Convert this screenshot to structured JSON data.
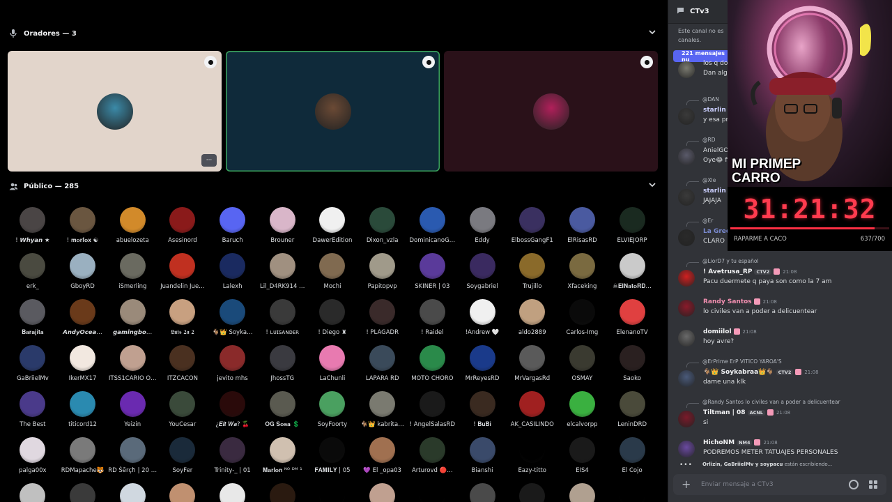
{
  "stage": {
    "speakers_header": "Oradores — 3",
    "audience_header": "Público — 285",
    "speakers": [
      {
        "bg": "#e2d5cb",
        "avatar_color": "#3b8aa8",
        "selected": false,
        "has_more": true
      },
      {
        "bg": "#0f2a3a",
        "avatar_color": "#6b4a35",
        "selected": true,
        "has_more": false
      },
      {
        "bg": "#2a1119",
        "avatar_color": "#b0205a",
        "selected": false,
        "has_more": false
      }
    ],
    "more_label": "···",
    "audience": [
      {
        "name": "! 𝙒𝙝𝙮𝙖𝙣 ★",
        "color": "#4a4545"
      },
      {
        "name": "! 𝐦𝐨𝐫𝐟𝐨𝐱 ☯",
        "color": "#6a5640"
      },
      {
        "name": "abuelozeta",
        "color": "#d28a2a"
      },
      {
        "name": "Asesinord",
        "color": "#8a1a1a"
      },
      {
        "name": "Baruch",
        "color": "#5865f2"
      },
      {
        "name": "Brouner",
        "color": "#d9b6c9"
      },
      {
        "name": "DawerEdition",
        "color": "#f0f0f0"
      },
      {
        "name": "Dixon_vzla",
        "color": "#2a4a3a"
      },
      {
        "name": "DominicanoG…",
        "color": "#2a5ab0"
      },
      {
        "name": "Eddy",
        "color": "#7a7a80"
      },
      {
        "name": "ElbossGangF1",
        "color": "#3a3060"
      },
      {
        "name": "ElRisasRD",
        "color": "#4a5aa0"
      },
      {
        "name": "ELVIEJORP",
        "color": "#1a2a20"
      },
      {
        "name": "erk_",
        "color": "#4a4a40"
      },
      {
        "name": "GboyRD",
        "color": "#9ab0c0"
      },
      {
        "name": "iSmerling",
        "color": "#6a6a60"
      },
      {
        "name": "Juandelin Jue…",
        "color": "#c03020"
      },
      {
        "name": "Lalexh",
        "color": "#1a2a60"
      },
      {
        "name": "Lil_D4RK914 …",
        "color": "#a09080"
      },
      {
        "name": "Mochi",
        "color": "#806a50"
      },
      {
        "name": "Papitopvp",
        "color": "#a09a8a"
      },
      {
        "name": "SKINER | 03",
        "color": "#5a3a9a"
      },
      {
        "name": "Soygabriel",
        "color": "#3a2a60"
      },
      {
        "name": "Trujillo",
        "color": "#8a6a2a"
      },
      {
        "name": "Xfaceking",
        "color": "#7a6a40"
      },
      {
        "name": "☠𝐄𝐥𝐍𝐚𝐭𝐨𝐑𝐃…",
        "color": "#cacaca"
      },
      {
        "name": "𝐁𝐚𝐫𝐚𝐣𝐢𝐭𝐚",
        "color": "#5a5a60"
      },
      {
        "name": "𝘼𝙣𝙙𝙮𝙊𝙘𝙚𝙖…",
        "color": "#6a3a1a"
      },
      {
        "name": "𝙜𝙖𝙢𝙞𝙣𝙜𝙗𝙤…",
        "color": "#9a8a7a"
      },
      {
        "name": "𝕷𝖚𝖎𝖘 𝟐𝖆 𝟐",
        "color": "#c8a080"
      },
      {
        "name": "🐐👑 Soyka…",
        "color": "#1a4a7a"
      },
      {
        "name": "! ʟᴜɪsᴀɴᴅᴇʀ",
        "color": "#3a3a3a"
      },
      {
        "name": "! Diego ♜",
        "color": "#2a2a2a"
      },
      {
        "name": "! PLAGADR",
        "color": "#3a2a2a"
      },
      {
        "name": "! Raidel",
        "color": "#4a4a4a"
      },
      {
        "name": "!Andrew 🤍",
        "color": "#f0f0f0"
      },
      {
        "name": "aldo2889",
        "color": "#c0a080"
      },
      {
        "name": "Carlos-Img",
        "color": "#0a0a0a"
      },
      {
        "name": "ElenanoTV",
        "color": "#e04040"
      },
      {
        "name": "GaBriielMv",
        "color": "#2a3a6a"
      },
      {
        "name": "IkerMX17",
        "color": "#f2e8e0"
      },
      {
        "name": "ITSS1CARIO O…",
        "color": "#c0a090"
      },
      {
        "name": "ITZCACON",
        "color": "#4a3020"
      },
      {
        "name": "jevito mhs",
        "color": "#8a2a2a"
      },
      {
        "name": "JhossTG",
        "color": "#3a3a40"
      },
      {
        "name": "LaChunli",
        "color": "#e87ab0"
      },
      {
        "name": "LAPARA RD",
        "color": "#3a4a5a"
      },
      {
        "name": "MOTO CHORO",
        "color": "#2a8a4a"
      },
      {
        "name": "MrReyesRD",
        "color": "#1a3a8a"
      },
      {
        "name": "MrVargasRd",
        "color": "#5a5a5a"
      },
      {
        "name": "OSMAY",
        "color": "#3a3a30"
      },
      {
        "name": "Saoko",
        "color": "#2a2020"
      },
      {
        "name": "The Best",
        "color": "#4a3a8a"
      },
      {
        "name": "titicord12",
        "color": "#2a8ab0"
      },
      {
        "name": "Yeizin",
        "color": "#6a2ab0"
      },
      {
        "name": "YouCesar",
        "color": "#3a4a3a"
      },
      {
        "name": "¿𝑬𝒍𝒕 𝑾𝒂? 🍒",
        "color": "#2a0a0a"
      },
      {
        "name": "𝐎𝐆 𝐒𝐨𝐬𝐚 💲",
        "color": "#5a5a50"
      },
      {
        "name": "SoyFoorty",
        "color": "#4aa060"
      },
      {
        "name": "🐐👑 kabrita…",
        "color": "#7a7a70"
      },
      {
        "name": "! AngelSalasRD",
        "color": "#1a1a1a"
      },
      {
        "name": "! 𝐁𝐮𝐁𝐢",
        "color": "#3a2a20"
      },
      {
        "name": "AK_CASILINDO",
        "color": "#a02020"
      },
      {
        "name": "elcalvorpp",
        "color": "#3ab040"
      },
      {
        "name": "LeninDRD",
        "color": "#4a4a3a"
      },
      {
        "name": "palga00x",
        "color": "#e0d8e0"
      },
      {
        "name": "RDMapache🐯",
        "color": "#7a7a7a"
      },
      {
        "name": "RD Šērçħ | 20 …",
        "color": "#5a6a7a"
      },
      {
        "name": "SoyFer",
        "color": "#1a2a3a"
      },
      {
        "name": "Trinity-_ | 01",
        "color": "#3a2a40"
      },
      {
        "name": "𝐌𝐚𝐫𝐥𝐨𝐧 ᴺᴼ ᴰᴹ ¹",
        "color": "#d0c0b0"
      },
      {
        "name": "𝐅𝐀𝐌𝐈𝐋𝐘 | 05",
        "color": "#0a0a0a"
      },
      {
        "name": "💜 El _opa03",
        "color": "#a07050"
      },
      {
        "name": "Arturovd 🔴…",
        "color": "#2a3a2a"
      },
      {
        "name": "Bianshi",
        "color": "#3a4a6a"
      },
      {
        "name": "Eazy-titto",
        "color": "#000000"
      },
      {
        "name": "EIS4",
        "color": "#1a1a1a"
      },
      {
        "name": "El Cojo",
        "color": "#2a3a4a"
      },
      {
        "name": "",
        "color": "#c0c0c0"
      },
      {
        "name": "",
        "color": "#3a3a3a"
      },
      {
        "name": "",
        "color": "#d0d8e0"
      },
      {
        "name": "",
        "color": "#c09070"
      },
      {
        "name": "",
        "color": "#e8e8e8"
      },
      {
        "name": "",
        "color": "#2a1a10"
      },
      {
        "name": "",
        "color": "#000000"
      },
      {
        "name": "",
        "color": "#c0a090"
      },
      {
        "name": "",
        "color": "#000000"
      },
      {
        "name": "",
        "color": "#4a4a4a"
      },
      {
        "name": "",
        "color": "#1a1a1a"
      },
      {
        "name": "",
        "color": "#b0a090"
      },
      {
        "name": "",
        "color": "#000000"
      }
    ]
  },
  "chat": {
    "channel": "CTv3",
    "notice": "Este canal no es canales.",
    "new_messages": "221 mensajes nu",
    "composer_placeholder": "Enviar mensaje a CTv3",
    "typing_names": "Orlizin, GaBriielMv y soypacu",
    "typing_suffix": "están escribiendo...",
    "messages": [
      {
        "user": "",
        "user_color": "#dbdee1",
        "ts": "",
        "lines": [
          "los q do",
          "Dan alg"
        ],
        "avatar": "#7a7a70"
      },
      {
        "reply": "@DAN",
        "user": "starlin",
        "user_color": "#c9cdfb",
        "ts": "",
        "lines": [
          "y esa pr"
        ],
        "avatar": "#3a3a3a"
      },
      {
        "reply": "@RD",
        "user": "",
        "user_color": "#dbdee1",
        "ts": "",
        "lines": [
          "AnielGO",
          "Oye😂 fi"
        ],
        "avatar": "#5a5a6a"
      },
      {
        "reply": "@Xle",
        "user": "starlin",
        "user_color": "#c9cdfb",
        "ts": "",
        "lines": [
          "JAJAJA"
        ],
        "avatar": "#3a3a3a"
      },
      {
        "reply": "@Er",
        "user": "La Gree",
        "user_color": "#7a8ad0",
        "ts": "",
        "lines": [
          "CLARO"
        ],
        "avatar": "#2a2a2a"
      },
      {
        "reply": "@LiorD7 y tu español",
        "user": "! Avetrusa_RP",
        "user_color": "#f2f3f5",
        "tag": "CTV2",
        "ts": "21:08",
        "lines": [
          "Pacu duermete q paya son como la 7 am"
        ],
        "avatar": "#d02020"
      },
      {
        "user": "Randy Santos",
        "user_color": "#f28fb0",
        "ts": "21:08",
        "lines": [
          "lo civiles van a poder a delicuentear"
        ],
        "avatar": "#8a1a2a"
      },
      {
        "user": "domiilol",
        "user_color": "#f2f3f5",
        "ts": "21:08",
        "lines": [
          "hoy avre?"
        ],
        "avatar": "#6a6a6a"
      },
      {
        "reply": "@ErPrime   ErP VITICO YAROA'S",
        "user": "🐐👑 Soykabraa👑🐐",
        "user_color": "#f2f3f5",
        "tag": "CTV2",
        "ts": "21:08",
        "lines": [
          "dame una klk"
        ],
        "avatar": "#4a5a7a"
      },
      {
        "reply": "@Randy Santos lo civiles van a poder a delicuentear",
        "user": "Tiltman | 08",
        "user_color": "#f2f3f5",
        "tag": "ACNL",
        "ts": "21:08",
        "lines": [
          "si"
        ],
        "avatar": "#7a1a2a"
      },
      {
        "user": "HichoNM",
        "user_color": "#f2f3f5",
        "tag": "NM4",
        "ts": "21:08",
        "lines": [
          "PODREMOS METER TATUAJES PERSONALES"
        ],
        "avatar": "#6a4aa0"
      }
    ]
  },
  "stream": {
    "title_line1": "MI PRIMEP",
    "title_line2": "CARRO",
    "timer": "31:21:32",
    "goal_label": "RAPARME A CACO",
    "goal_count": "637/700",
    "goal_fraction": 0.91
  }
}
